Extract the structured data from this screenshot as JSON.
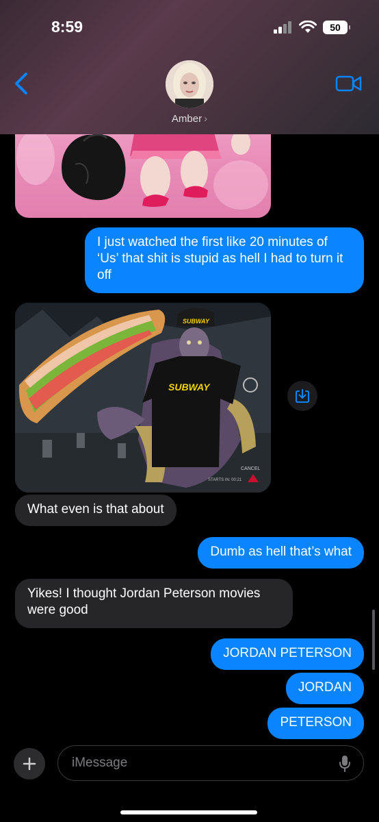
{
  "status": {
    "time": "8:59",
    "battery": "50"
  },
  "header": {
    "contact_name": "Amber",
    "chevron": "›"
  },
  "messages": {
    "m1": "I just watched the first like 20 minutes of ‘Us’ that shit is stupid as hell I had to turn it off",
    "m2": "What even is that about",
    "m3": "Dumb as hell that’s what",
    "m4": "Yikes! I thought Jordan Peterson movies were good",
    "m5": "JORDAN PETERSON",
    "m6": "JORDAN",
    "m7": "PETERSON"
  },
  "meme": {
    "hat_text": "SUBWAY",
    "shirt_text": "SUBWAY",
    "cancel_text": "CANCEL",
    "starts_text": "STARTS IN: 00:21"
  },
  "composer": {
    "placeholder": "iMessage"
  },
  "icons": {
    "back": "chevron-left-icon",
    "video": "video-camera-icon",
    "save": "save-download-icon",
    "plus": "plus-icon",
    "mic": "microphone-icon"
  },
  "colors": {
    "sent_bubble": "#0a84ff",
    "received_bubble": "#262629",
    "accent": "#0a84ff"
  }
}
